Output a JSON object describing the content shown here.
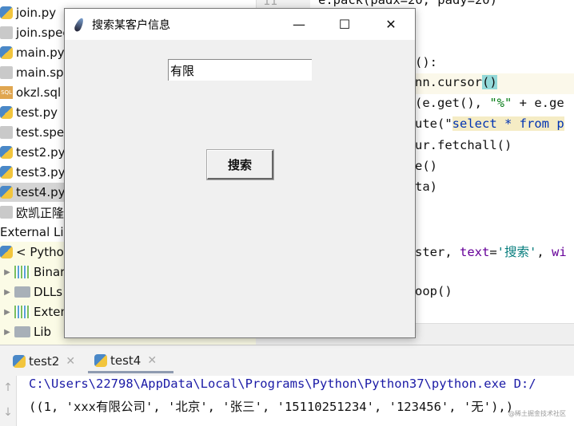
{
  "project": {
    "items": [
      {
        "label": "join.py",
        "icon": "python-file-icon"
      },
      {
        "label": "join.spec",
        "icon": "text-file-icon"
      },
      {
        "label": "main.py",
        "icon": "python-file-icon"
      },
      {
        "label": "main.spec",
        "icon": "text-file-icon"
      },
      {
        "label": "okzl.sql",
        "icon": "sql-file-icon"
      },
      {
        "label": "test.py",
        "icon": "python-file-icon"
      },
      {
        "label": "test.spec",
        "icon": "text-file-icon"
      },
      {
        "label": "test2.py",
        "icon": "python-file-icon"
      },
      {
        "label": "test3.py",
        "icon": "python-file-icon"
      },
      {
        "label": "test4.py",
        "icon": "python-file-icon"
      },
      {
        "label": "欧凯正隆",
        "icon": "archive-file-icon"
      }
    ],
    "external": "External Lib",
    "python_sdk": "< Python",
    "libs": [
      {
        "label": "Binary",
        "icon": "library-icon"
      },
      {
        "label": "DLLs",
        "icon": "folder-icon"
      },
      {
        "label": "Exten",
        "icon": "library-icon"
      },
      {
        "label": "Lib",
        "icon": "folder-icon"
      }
    ],
    "sql_badge": "SQL"
  },
  "editor": {
    "gutter_line": "11",
    "line0": "e.pack(padx=20, pady=20)",
    "l1": "():",
    "l2a": "nn.cursor",
    "l2b": "()",
    "l3a": "(e.get(), ",
    "l3b": "\"%\"",
    "l3c": " + e.ge",
    "l4a": "ute(\"",
    "l4b": "select * from p",
    "l5": "ur.fetchall()",
    "l6": "e()",
    "l7": "ta)",
    "l8a": "ster, ",
    "l8b": "text",
    "l8c": "=",
    "l8d": "'搜索'",
    "l8e": ", ",
    "l8f": "wi",
    "l9": "oop()"
  },
  "dialog": {
    "title": "搜索某客户信息",
    "minimize": "—",
    "maximize": "☐",
    "close": "✕",
    "entry_value": "有限",
    "search_button": "搜索"
  },
  "run": {
    "tabs": [
      {
        "label": "test2",
        "close": "✕"
      },
      {
        "label": "test4",
        "close": "✕"
      }
    ],
    "active_tab": 1,
    "up": "↑",
    "down": "↓",
    "cmd": "C:\\Users\\22798\\AppData\\Local\\Programs\\Python\\Python37\\python.exe D:/",
    "output": "((1, 'xxx有限公司', '北京', '张三', '15110251234', '123456', '无'),)"
  },
  "watermark": "@稀土掘金技术社区",
  "colors": {
    "cmd": "#1a1aa6",
    "accent_tab": "#8f9bb0"
  }
}
